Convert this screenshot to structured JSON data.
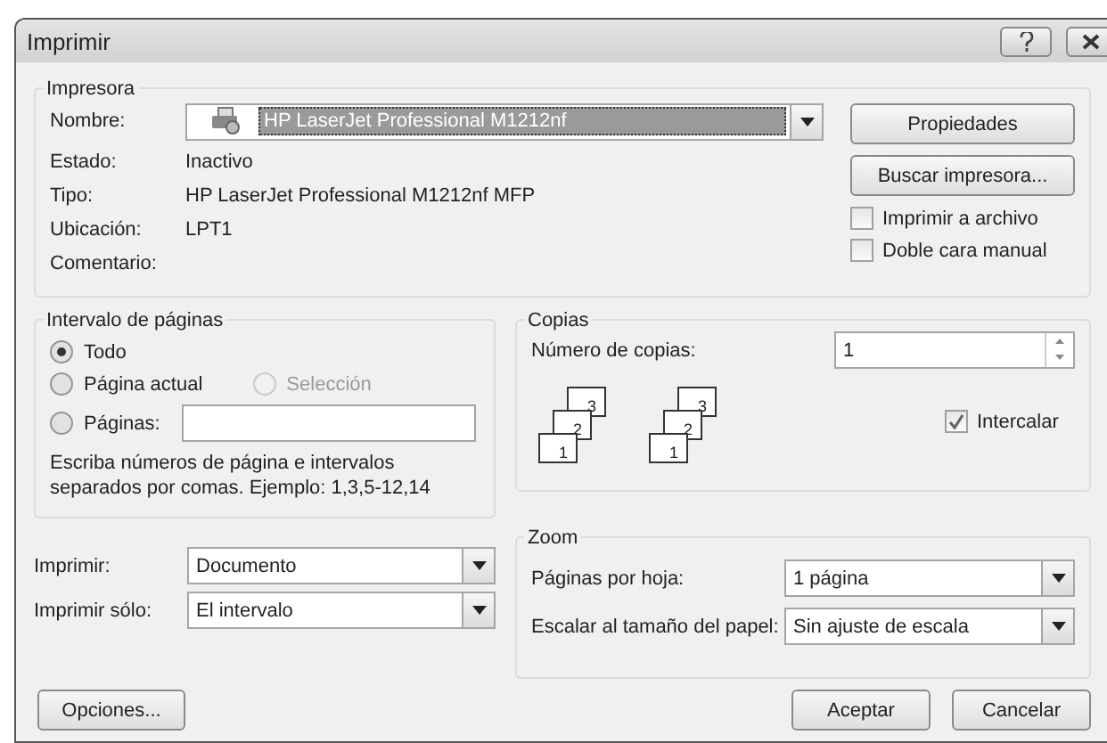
{
  "window": {
    "title": "Imprimir"
  },
  "printer": {
    "title": "Impresora",
    "name_label": "Nombre:",
    "name_value": "HP LaserJet Professional M1212nf",
    "info": [
      {
        "label": "Estado:",
        "value": "Inactivo"
      },
      {
        "label": "Tipo:",
        "value": "HP LaserJet Professional M1212nf MFP"
      },
      {
        "label": "Ubicación:",
        "value": "LPT1"
      },
      {
        "label": "Comentario:"
      }
    ],
    "buttons": [
      "Propiedades",
      "Buscar impresora..."
    ],
    "checkboxes": [
      {
        "label": "Imprimir a archivo",
        "checked": false
      },
      {
        "label": "Doble cara manual",
        "checked": false
      }
    ]
  },
  "range": {
    "title": "Intervalo de páginas",
    "options": [
      {
        "label": "Todo",
        "selected": true,
        "disabled": false
      },
      {
        "label": "Página actual",
        "selected": false,
        "disabled": false
      },
      {
        "label": "Selección",
        "selected": false,
        "disabled": true
      },
      {
        "label": "Páginas:",
        "selected": false,
        "disabled": false
      }
    ],
    "hint": "Escriba números de página e intervalos separados por comas. Ejemplo: 1,3,5-12,14"
  },
  "copies": {
    "title": "Copias",
    "count_label": "Número de copias:",
    "count_value": "1",
    "stacks": [
      [
        "1",
        "2",
        "3"
      ],
      [
        "1",
        "2",
        "3"
      ]
    ],
    "collate": {
      "label": "Intercalar",
      "checked": true
    }
  },
  "print_what": [
    {
      "label": "Imprimir:",
      "value": "Documento"
    },
    {
      "label": "Imprimir sólo:",
      "value": "El intervalo"
    }
  ],
  "zoom": {
    "title": "Zoom",
    "rows": [
      {
        "label": "Páginas por hoja:",
        "value": "1 página"
      },
      {
        "label": "Escalar al tamaño del papel:",
        "value": "Sin ajuste de escala"
      }
    ]
  },
  "footer": {
    "options": "Opciones...",
    "ok": "Aceptar",
    "cancel": "Cancelar"
  }
}
